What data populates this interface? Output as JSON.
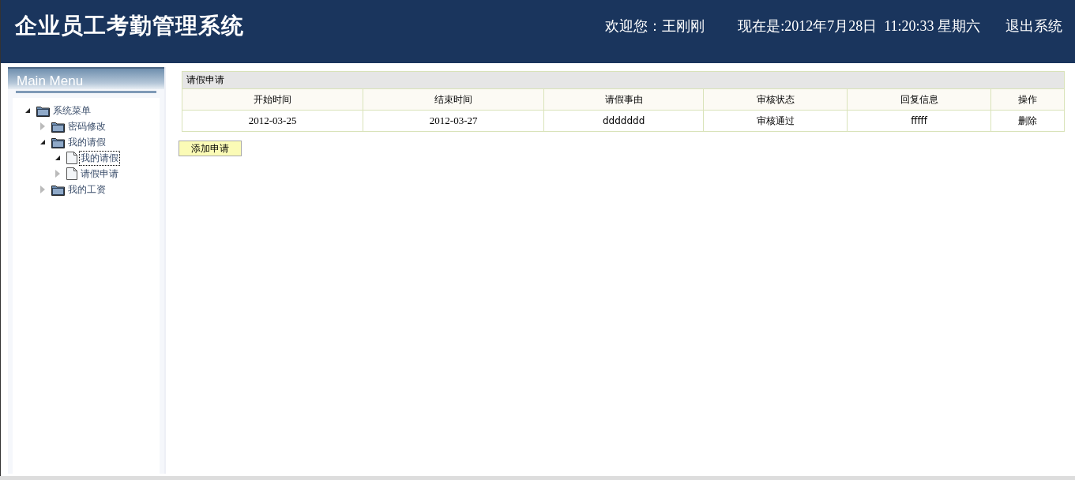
{
  "header": {
    "title": "企业员工考勤管理系统",
    "welcome": "欢迎您：王刚刚",
    "datetime": "现在是:2012年7月28日  11:20:33 星期六",
    "logout": "退出系统"
  },
  "sidebar": {
    "title": "Main Menu",
    "tree": [
      {
        "label": "系统菜单",
        "kind": "folder",
        "expanded": true,
        "selected": false,
        "children": [
          {
            "label": "密码修改",
            "kind": "folder",
            "expanded": false,
            "selected": false
          },
          {
            "label": "我的请假",
            "kind": "folder",
            "expanded": true,
            "selected": false,
            "children": [
              {
                "label": "我的请假",
                "kind": "file",
                "expanded": true,
                "selected": true
              },
              {
                "label": "请假申请",
                "kind": "file",
                "expanded": false,
                "selected": false
              }
            ]
          },
          {
            "label": "我的工资",
            "kind": "folder",
            "expanded": false,
            "selected": false
          }
        ]
      }
    ]
  },
  "table": {
    "caption": "请假申请",
    "columns": [
      "开始时间",
      "结束时间",
      "请假事由",
      "审核状态",
      "回复信息",
      "操作"
    ],
    "rows": [
      [
        "2012-03-25",
        "2012-03-27",
        "ddddddd",
        "审核通过",
        "fffff",
        "删除"
      ]
    ]
  },
  "add_button": "添加申请"
}
